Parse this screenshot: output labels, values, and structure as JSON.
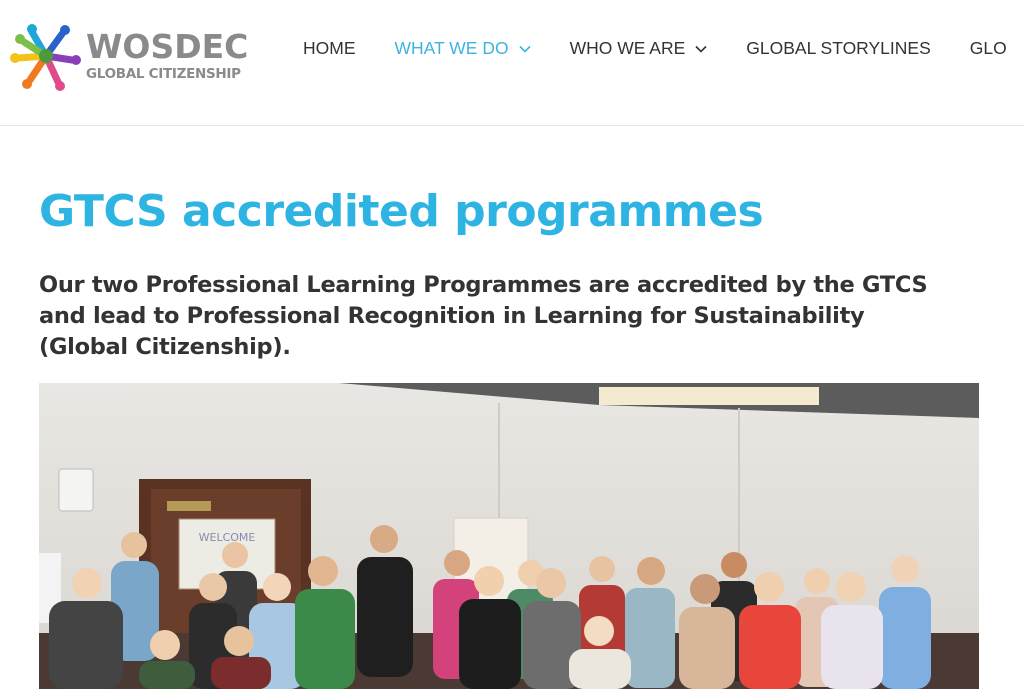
{
  "site": {
    "logo_word": "WOSDEC",
    "logo_subtitle": "GLOBAL CITIZENSHIP",
    "nav": [
      {
        "label": "HOME",
        "active": false,
        "dropdown": false
      },
      {
        "label": "WHAT WE DO",
        "active": true,
        "dropdown": true
      },
      {
        "label": "WHO WE ARE",
        "active": false,
        "dropdown": true
      },
      {
        "label": "GLOBAL STORYLINES",
        "active": false,
        "dropdown": false
      },
      {
        "label": "GLO",
        "active": false,
        "dropdown": false
      }
    ]
  },
  "page": {
    "title": "GTCS accredited programmes",
    "lead": "Our two Professional Learning Programmes are accredited by the GTCS and lead to Professional Recognition in Learning for Sustainability (Global Citizenship).",
    "photo_sign": "WELCOME"
  },
  "colors": {
    "accent": "#2eb4e2",
    "nav_active": "#3fb3e0",
    "text": "#333333",
    "logo_grey": "#8a8a8a"
  }
}
